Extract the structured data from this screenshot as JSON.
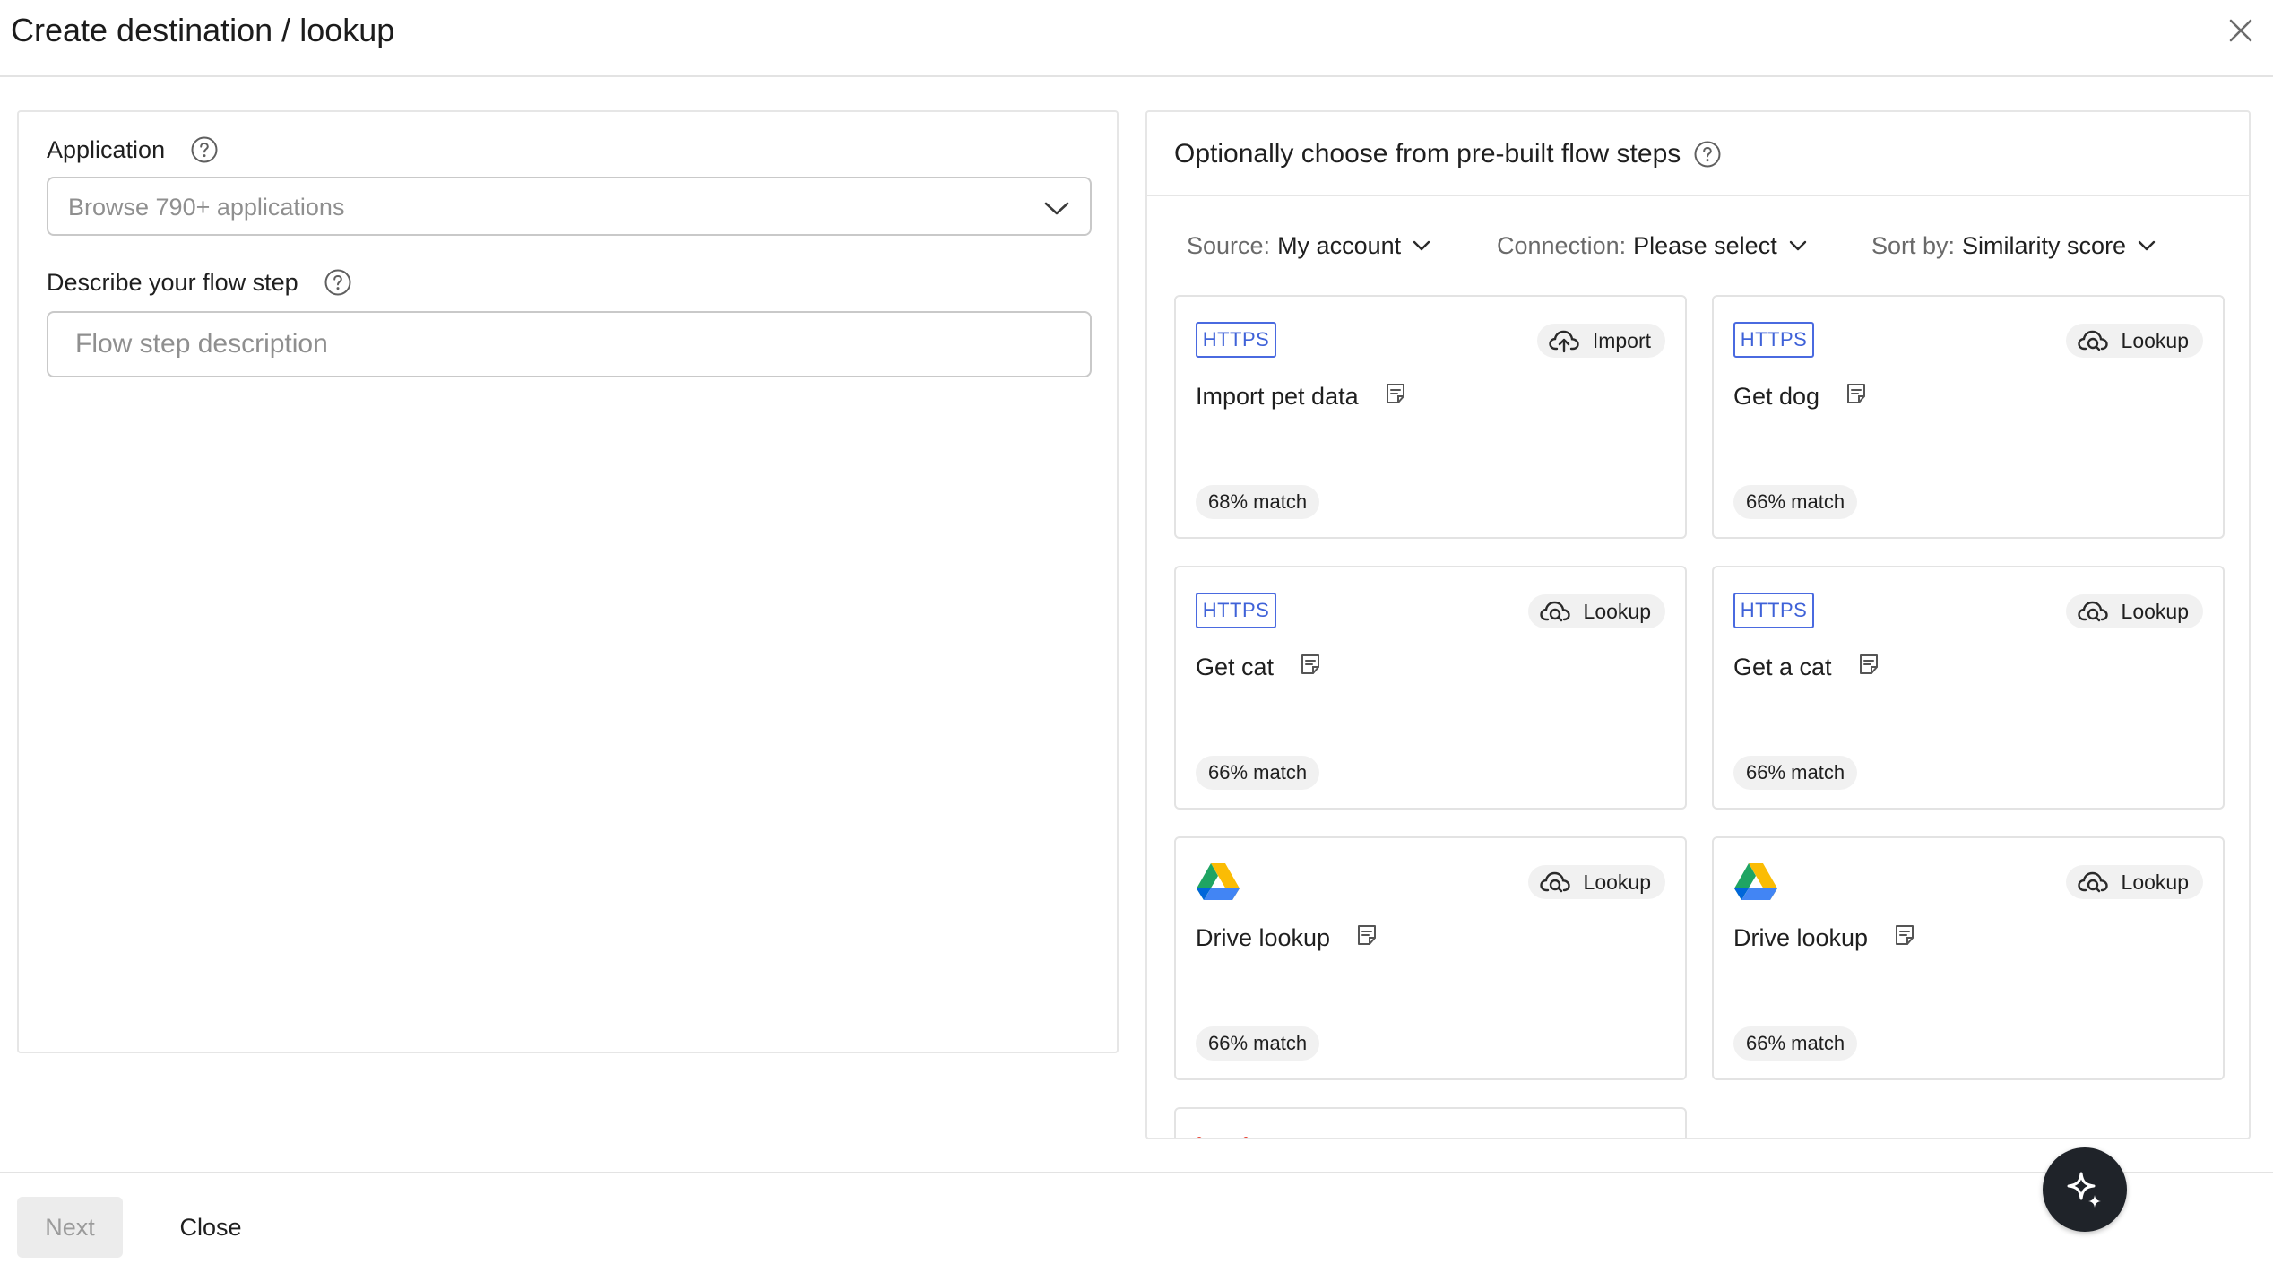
{
  "dialog": {
    "title": "Create destination / lookup",
    "close_icon": "close-icon"
  },
  "application": {
    "label": "Application",
    "placeholder": "Browse 790+ applications"
  },
  "flow_step": {
    "label": "Describe your flow step",
    "placeholder": "Flow step description"
  },
  "prebuilt": {
    "title": "Optionally choose from pre-built flow steps",
    "filters": [
      {
        "key": "Source:",
        "value": "My account"
      },
      {
        "key": "Connection:",
        "value": "Please select"
      },
      {
        "key": "Sort by:",
        "value": "Similarity score"
      }
    ],
    "cards": [
      {
        "connector": "HTTPS",
        "type": "Import",
        "title": "Import pet data",
        "match": "68% match"
      },
      {
        "connector": "HTTPS",
        "type": "Lookup",
        "title": "Get dog",
        "match": "66% match"
      },
      {
        "connector": "HTTPS",
        "type": "Lookup",
        "title": "Get cat",
        "match": "66% match"
      },
      {
        "connector": "HTTPS",
        "type": "Lookup",
        "title": "Get a cat",
        "match": "66% match"
      },
      {
        "connector": "google-drive-logo",
        "type": "Lookup",
        "title": "Drive lookup",
        "match": "66% match"
      },
      {
        "connector": "google-drive-logo",
        "type": "Lookup",
        "title": "Drive lookup",
        "match": "66% match"
      }
    ]
  },
  "footer": {
    "next_label": "Next",
    "close_label": "Close"
  },
  "colors": {
    "https_badge": "#3f62d8",
    "fab_bg": "#1f2329"
  }
}
